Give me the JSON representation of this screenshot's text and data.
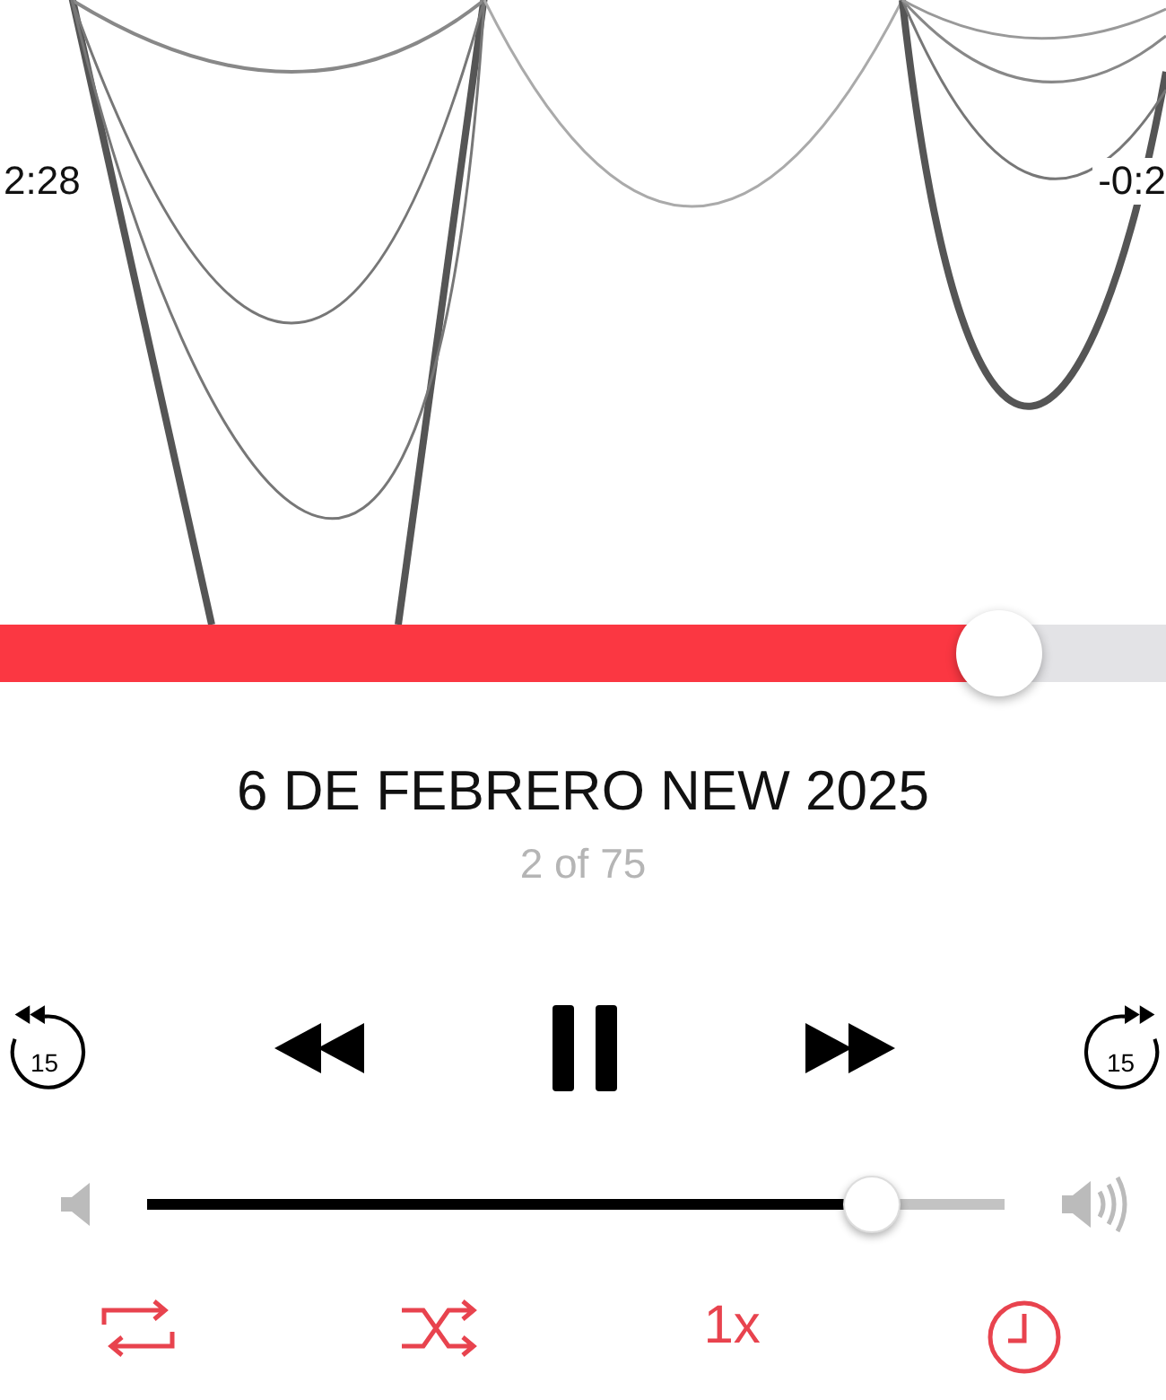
{
  "scrubber": {
    "elapsed": "2:28",
    "remaining": "-0:2",
    "level": 0.857
  },
  "episode": {
    "title": "6 DE FEBRERO NEW 2025",
    "position": "2 of 75"
  },
  "transport": {
    "skip_back": "15",
    "skip_forward": "15",
    "playing": true
  },
  "volume": {
    "level": 0.846
  },
  "options": {
    "speed": "1x"
  }
}
